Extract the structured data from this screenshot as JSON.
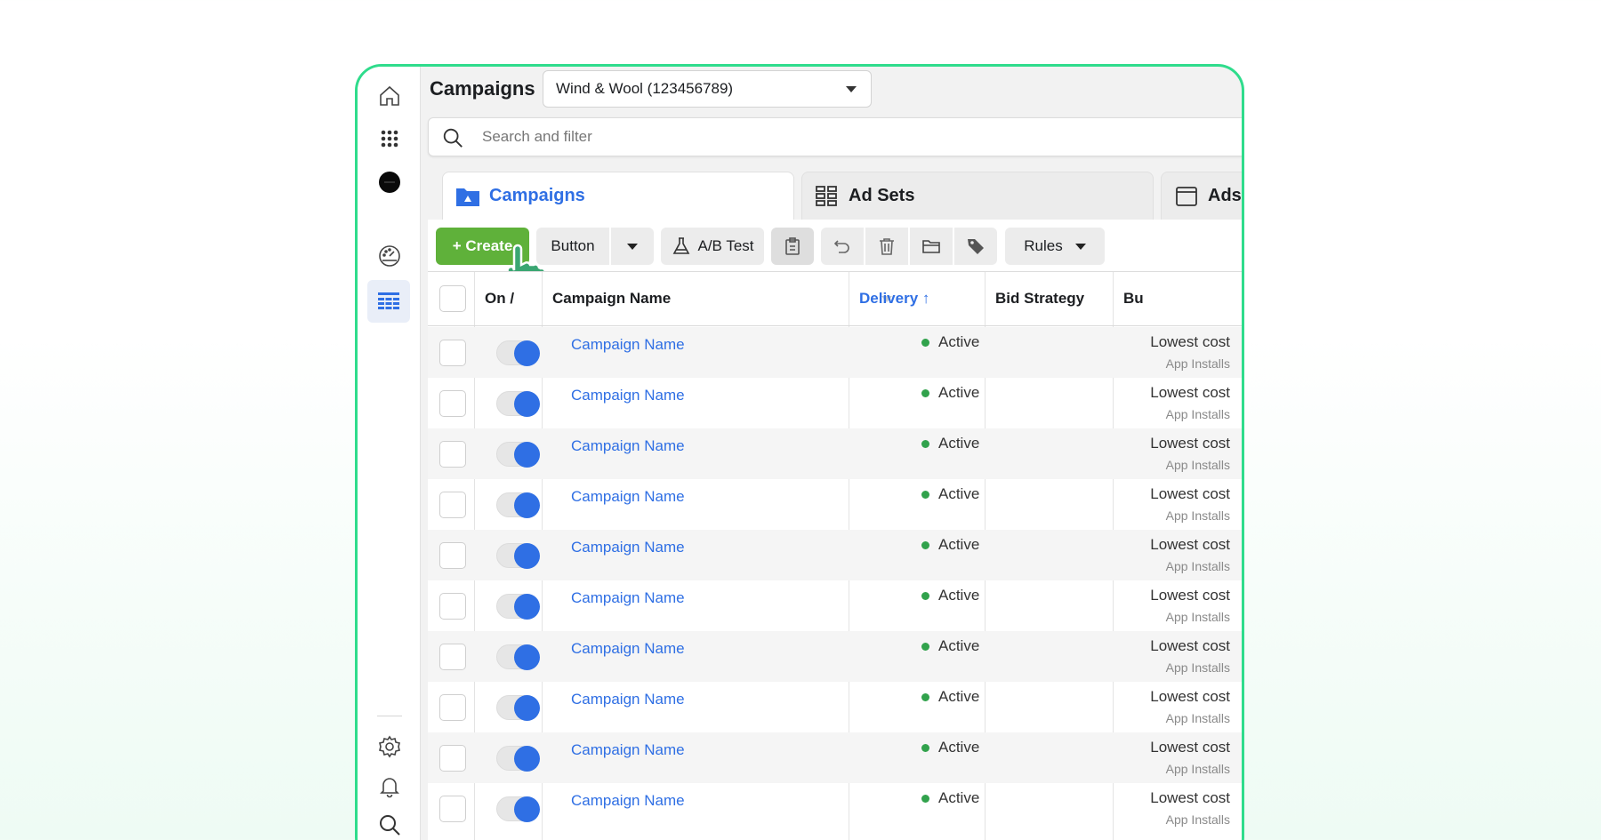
{
  "header": {
    "title": "Campaigns",
    "account_selected": "Wind & Wool (123456789)"
  },
  "search": {
    "placeholder": "Search and filter"
  },
  "tabs": [
    {
      "label": "Campaigns",
      "icon": "campaign-folder-icon",
      "active": true
    },
    {
      "label": "Ad Sets",
      "icon": "grid-icon",
      "active": false
    },
    {
      "label": "Ads",
      "icon": "ad-window-icon",
      "active": false
    }
  ],
  "toolbar": {
    "create_label": "+ Create",
    "button_label": "Button",
    "abtest_label": "A/B Test",
    "rules_label": "Rules"
  },
  "rail": {
    "icons": [
      "home-icon",
      "apps-grid-icon",
      "account-avatar-icon",
      "performance-gauge-icon",
      "ads-manager-table-icon",
      "settings-gear-icon",
      "notifications-bell-icon",
      "search-icon"
    ]
  },
  "table": {
    "columns": [
      "On /",
      "Campaign Name",
      "Delivery ↑",
      "Bid Strategy",
      "Bu"
    ],
    "rows": [
      {
        "name": "Campaign Name",
        "status": "Active",
        "bid": "Lowest cost",
        "bid_sub": "App Installs"
      },
      {
        "name": "Campaign Name",
        "status": "Active",
        "bid": "Lowest cost",
        "bid_sub": "App Installs"
      },
      {
        "name": "Campaign Name",
        "status": "Active",
        "bid": "Lowest cost",
        "bid_sub": "App Installs"
      },
      {
        "name": "Campaign Name",
        "status": "Active",
        "bid": "Lowest cost",
        "bid_sub": "App Installs"
      },
      {
        "name": "Campaign Name",
        "status": "Active",
        "bid": "Lowest cost",
        "bid_sub": "App Installs"
      },
      {
        "name": "Campaign Name",
        "status": "Active",
        "bid": "Lowest cost",
        "bid_sub": "App Installs"
      },
      {
        "name": "Campaign Name",
        "status": "Active",
        "bid": "Lowest cost",
        "bid_sub": "App Installs"
      },
      {
        "name": "Campaign Name",
        "status": "Active",
        "bid": "Lowest cost",
        "bid_sub": "App Installs"
      },
      {
        "name": "Campaign Name",
        "status": "Active",
        "bid": "Lowest cost",
        "bid_sub": "App Installs"
      },
      {
        "name": "Campaign Name",
        "status": "Active",
        "bid": "Lowest cost",
        "bid_sub": "App Installs"
      }
    ]
  },
  "colors": {
    "frame_border": "#2fdc8c",
    "accent_blue": "#2f6fe4",
    "create_green": "#5fb13a",
    "status_green": "#31a24c"
  }
}
